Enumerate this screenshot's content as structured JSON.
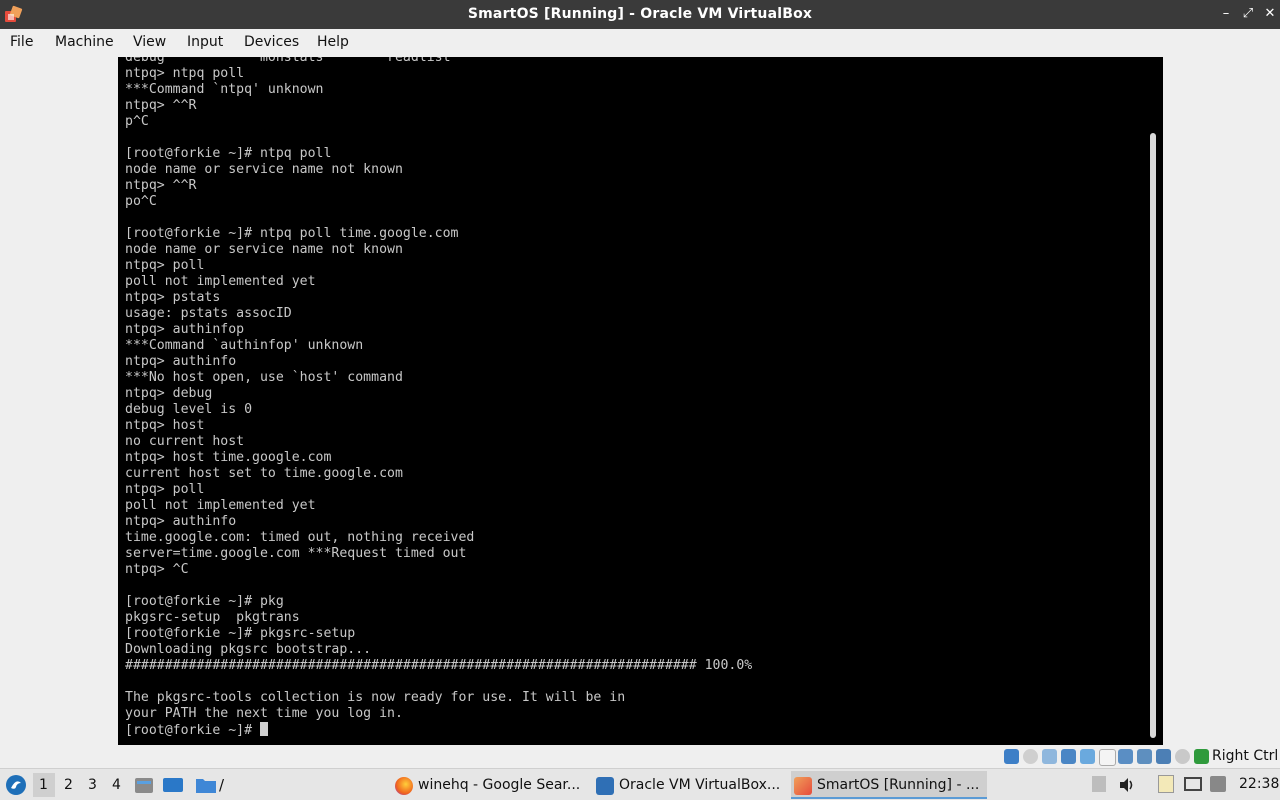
{
  "window": {
    "title": "SmartOS [Running] - Oracle VM VirtualBox"
  },
  "menu": [
    "File",
    "Machine",
    "View",
    "Input",
    "Devices",
    "Help"
  ],
  "terminal": {
    "lines": [
      "debug            monstats        readlist",
      "ntpq> ntpq poll",
      "***Command `ntpq' unknown",
      "ntpq> ^^R",
      "p^C",
      "",
      "[root@forkie ~]# ntpq poll",
      "node name or service name not known",
      "ntpq> ^^R",
      "po^C",
      "",
      "[root@forkie ~]# ntpq poll time.google.com",
      "node name or service name not known",
      "ntpq> poll",
      "poll not implemented yet",
      "ntpq> pstats",
      "usage: pstats assocID",
      "ntpq> authinfop",
      "***Command `authinfop' unknown",
      "ntpq> authinfo",
      "***No host open, use `host' command",
      "ntpq> debug",
      "debug level is 0",
      "ntpq> host",
      "no current host",
      "ntpq> host time.google.com",
      "current host set to time.google.com",
      "ntpq> poll",
      "poll not implemented yet",
      "ntpq> authinfo",
      "time.google.com: timed out, nothing received",
      "server=time.google.com ***Request timed out",
      "ntpq> ^C",
      "",
      "[root@forkie ~]# pkg",
      "pkgsrc-setup  pkgtrans",
      "[root@forkie ~]# pkgsrc-setup",
      "Downloading pkgsrc bootstrap...",
      "######################################################################## 100.0%",
      "",
      "The pkgsrc-tools collection is now ready for use. It will be in",
      "your PATH the next time you log in."
    ],
    "prompt": "[root@forkie ~]# "
  },
  "statusbar": {
    "host_key": "Right Ctrl",
    "icons": [
      "hard-disk-icon",
      "optical-drive-icon",
      "audio-icon",
      "network-icon",
      "usb-icon",
      "shared-folders-icon",
      "display-icon",
      "video-capture-icon",
      "cpu-icon",
      "mouse-integration-icon",
      "host-key-icon"
    ]
  },
  "taskbar": {
    "workspaces": [
      "1",
      "2",
      "3",
      "4"
    ],
    "quick_launch_separator": "/",
    "tasks": [
      {
        "label": "winehq - Google Sear...",
        "icon": "firefox-icon"
      },
      {
        "label": "Oracle VM VirtualBox...",
        "icon": "virtualbox-manager-icon"
      },
      {
        "label": "SmartOS [Running] - ...",
        "icon": "virtualbox-vm-icon"
      }
    ],
    "clock": "22:38",
    "colors": {
      "accent": "#1e6fb8",
      "active_task_border": "#5b9bd5"
    }
  }
}
